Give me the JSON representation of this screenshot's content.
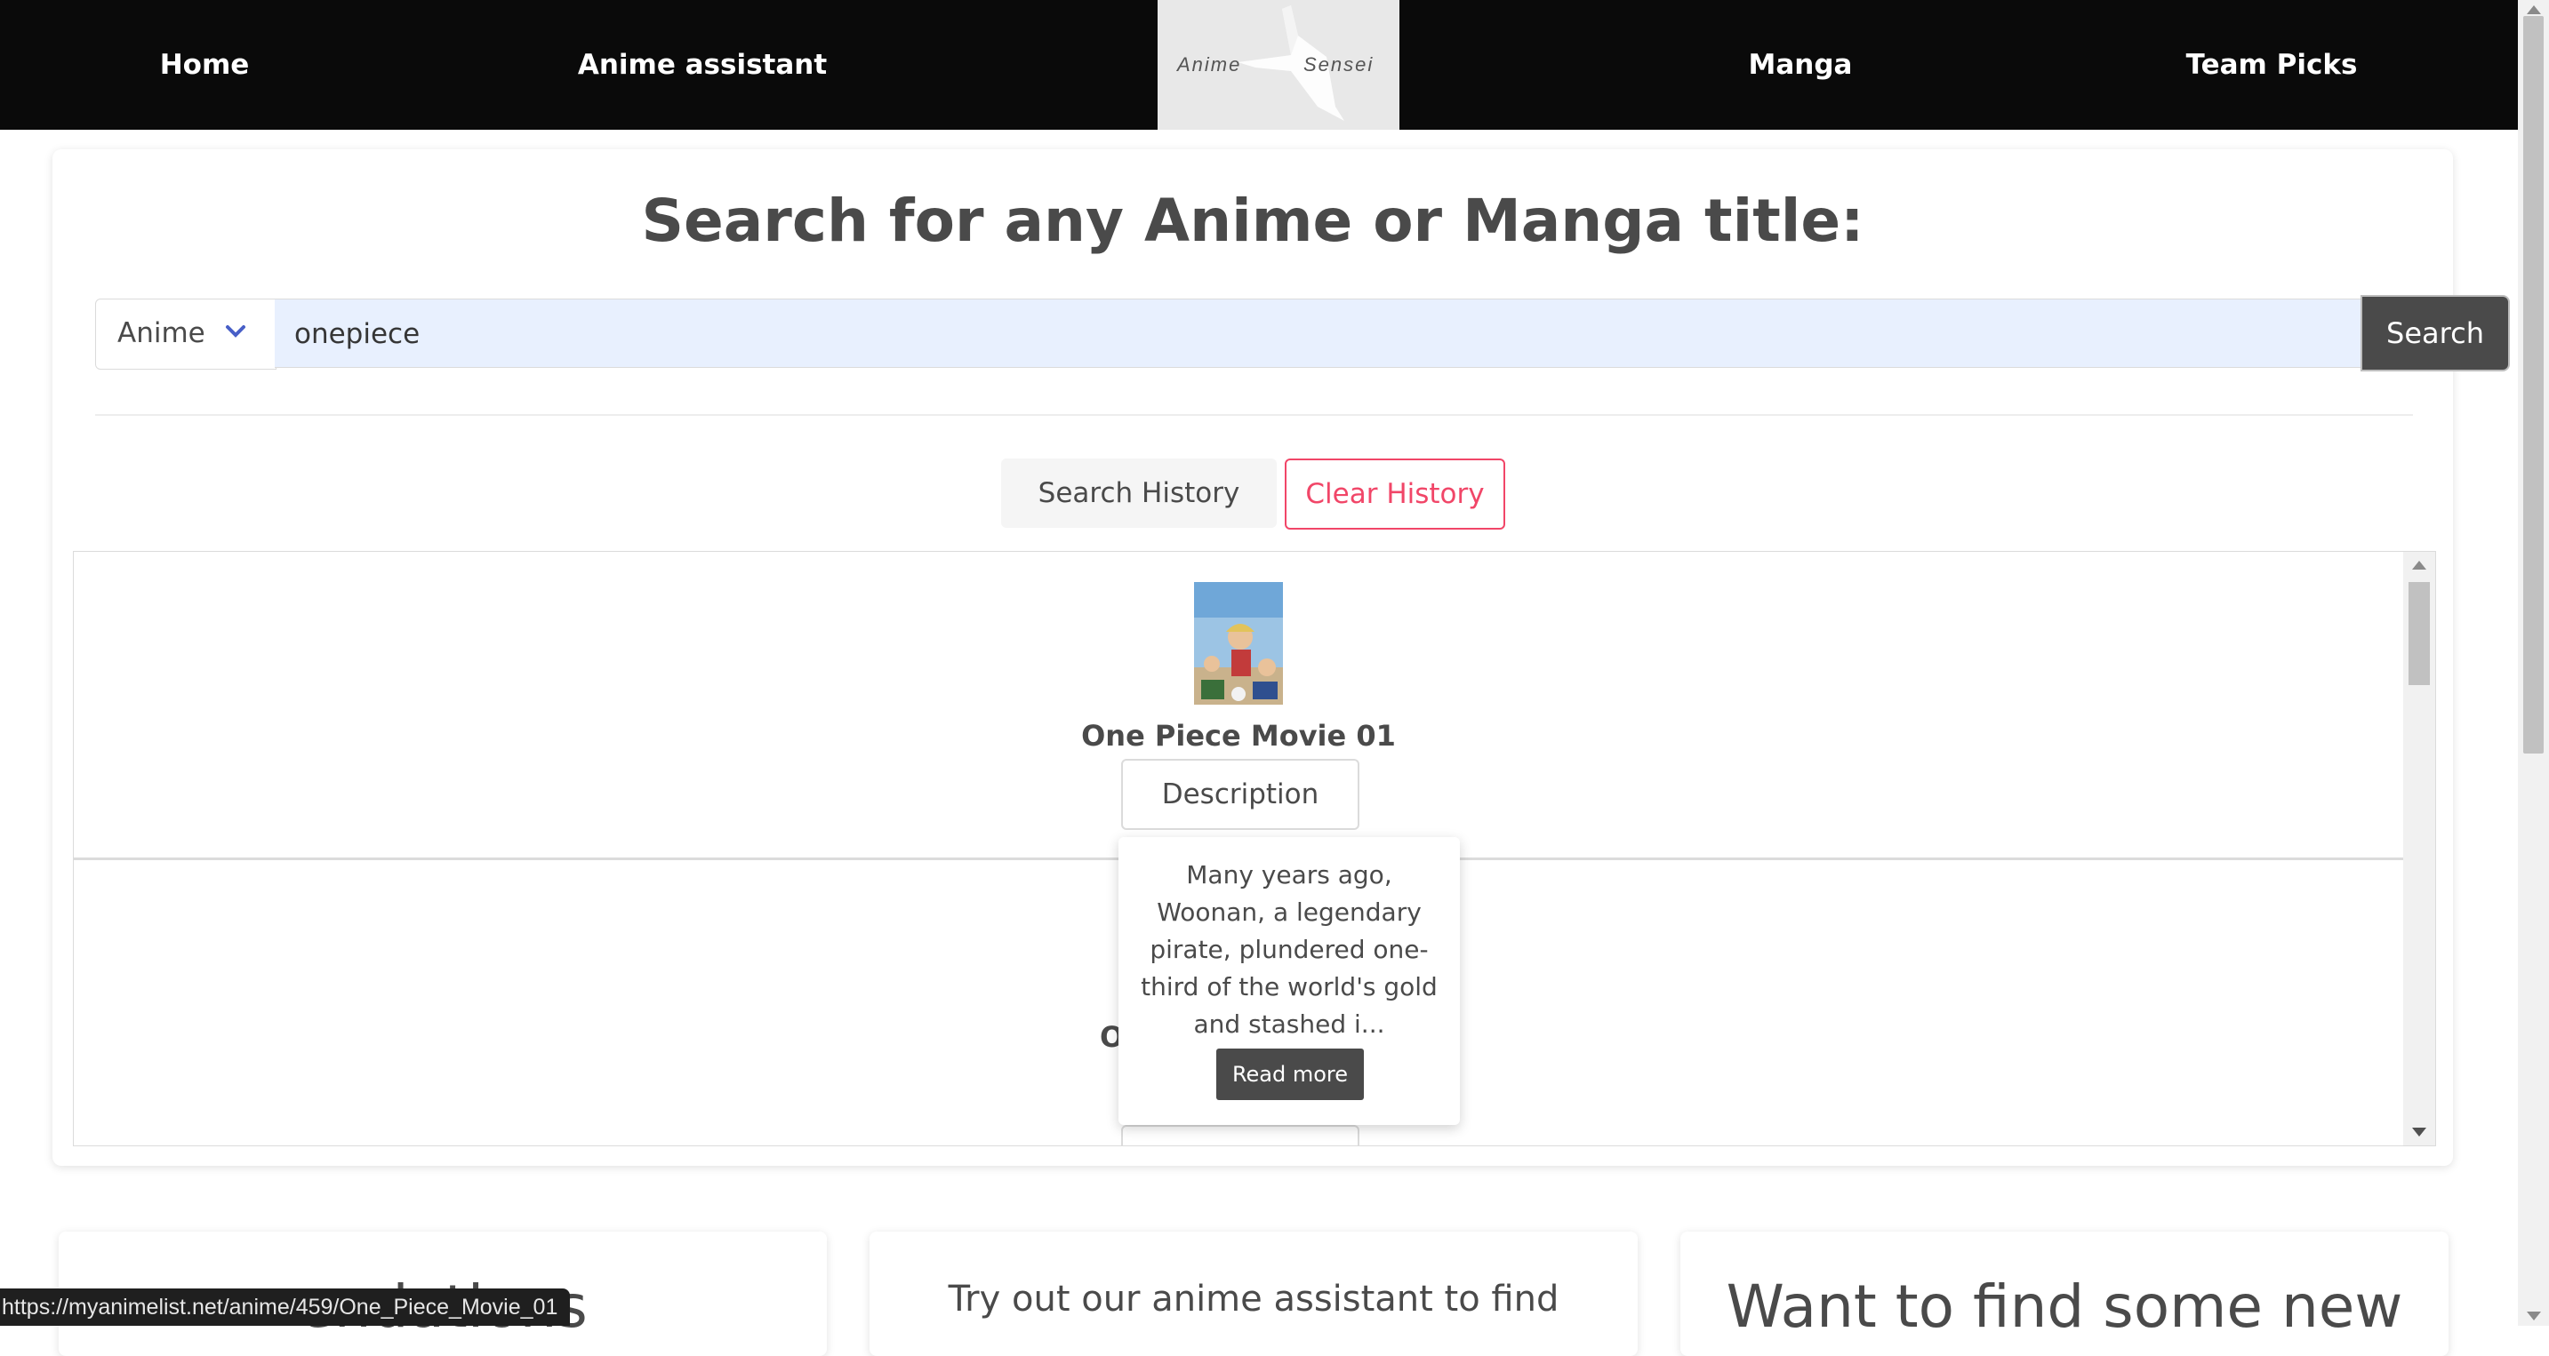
{
  "nav": {
    "home": "Home",
    "assistant": "Anime assistant",
    "logo_left": "Anime",
    "logo_right": "Sensei",
    "manga": "Manga",
    "picks": "Team Picks"
  },
  "search": {
    "heading": "Search for any Anime or Manga title:",
    "type_selected": "Anime",
    "query": "onepiece",
    "button": "Search"
  },
  "history": {
    "label": "Search History",
    "clear": "Clear History"
  },
  "results": [
    {
      "title": "One Piece Movie 01",
      "description_button": "Description"
    },
    {
      "title_fragment": "O"
    }
  ],
  "popover": {
    "text": "Many years ago, Woonan, a legendary pirate, plundered one-third of the world's gold and stashed i...",
    "read_more": "Read more"
  },
  "bottom_cards": {
    "card1_fragment": "endations",
    "card2": "Try out our anime assistant to find",
    "card3": "Want to find some new"
  },
  "status_url": "https://myanimelist.net/anime/459/One_Piece_Movie_01",
  "colors": {
    "nav_bg": "#0a0a0a",
    "dark_button": "#4a4a4a",
    "danger": "#f14668",
    "autofill": "#e8f0fe",
    "chevron": "#485fc7"
  }
}
